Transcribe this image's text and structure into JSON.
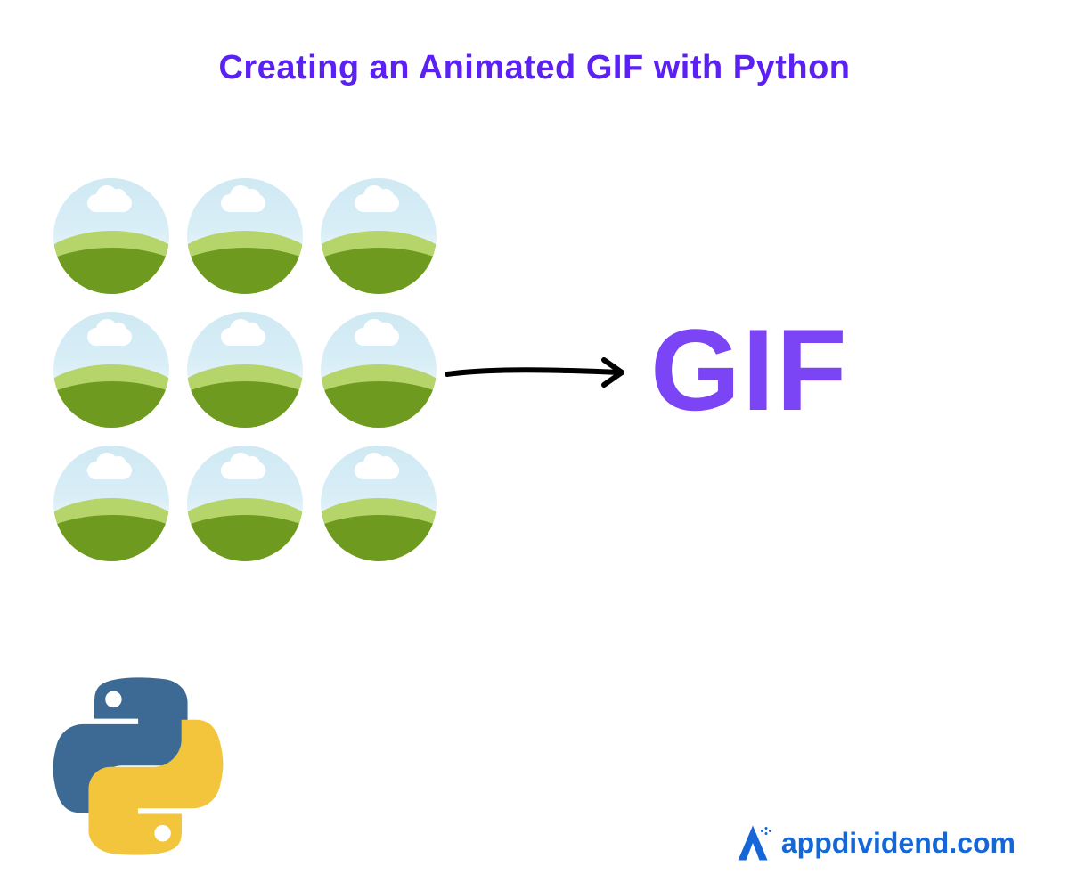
{
  "title": "Creating an Animated GIF with Python",
  "output_label": "GIF",
  "brand": {
    "text": "appdividend.com"
  },
  "grid": {
    "rows": 3,
    "cols": 3
  },
  "colors": {
    "title": "#5B21F3",
    "gif_label": "#7B44F4",
    "brand_text": "#1566d6",
    "python_blue": "#306998",
    "python_yellow": "#FFD43B",
    "hill_front": "#6e9a1f",
    "hill_back": "#b5d46a",
    "sky": "#cfe9f3"
  },
  "icons": {
    "frames": "landscape-circle-icon",
    "arrow": "arrow-right-icon",
    "python": "python-logo-icon",
    "brand": "appdividend-logo-icon"
  }
}
